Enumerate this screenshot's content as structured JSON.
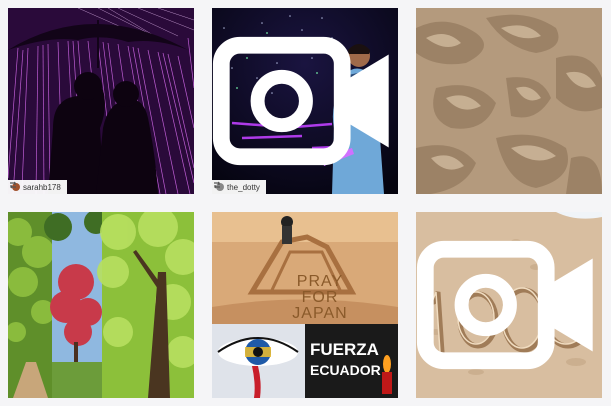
{
  "grid": {
    "tiles": [
      {
        "name": "umbrella-couple-sparks",
        "repost": {
          "username": "sarahb178"
        }
      },
      {
        "name": "performer-stage",
        "repost": {
          "username": "the_dotty"
        },
        "video": true
      },
      {
        "name": "sand-texture"
      },
      {
        "name": "tree-garden-collage"
      },
      {
        "name": "pray-for-japan-ecuador",
        "sand_text": "PRAY FOR JAPAN",
        "bottom_text_1": "FUERZA",
        "bottom_text_2": "ECUADOR"
      },
      {
        "name": "sand-1000",
        "video": true
      }
    ]
  },
  "icons": {
    "repost": "repost-icon",
    "video": "video-camera-icon"
  },
  "colors": {
    "background": "#f5f5f7",
    "caption_bg": "#ffffff"
  }
}
